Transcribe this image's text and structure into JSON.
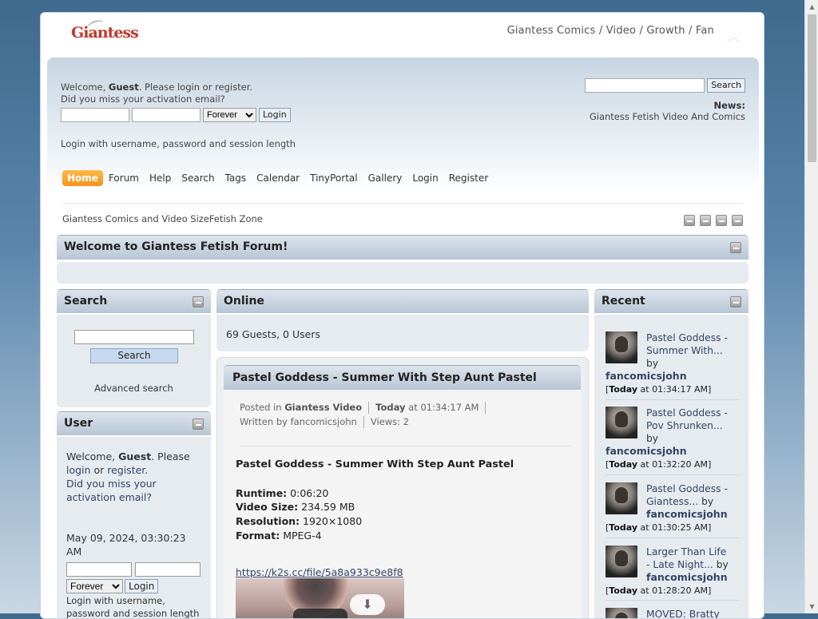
{
  "header": {
    "logo_text": "Giantess",
    "tagline": "Giantess Comics / Video / Growth / Fan"
  },
  "userbox": {
    "welcome_prefix": "Welcome,",
    "guest": "Guest",
    "welcome_suffix": ". Please login or register.",
    "activation": "Did you miss your activation email?",
    "session_option": "Forever",
    "login_button": "Login",
    "login_help": "Login with username, password and session length"
  },
  "search_top": {
    "button": "Search"
  },
  "news": {
    "label": "News:",
    "text": "Giantess Fetish Video And Comics"
  },
  "menu": {
    "items": [
      {
        "label": "Home"
      },
      {
        "label": "Forum"
      },
      {
        "label": "Help"
      },
      {
        "label": "Search"
      },
      {
        "label": "Tags"
      },
      {
        "label": "Calendar"
      },
      {
        "label": "TinyPortal"
      },
      {
        "label": "Gallery"
      },
      {
        "label": "Login"
      },
      {
        "label": "Register"
      }
    ]
  },
  "breadcrumb": "Giantess Comics and Video SizeFetish Zone",
  "welcome_block": {
    "title": "Welcome to Giantess Fetish Forum!"
  },
  "search_block": {
    "title": "Search",
    "button": "Search",
    "advanced": "Advanced search"
  },
  "user_block": {
    "title": "User",
    "welcome_prefix": "Welcome,",
    "guest": "Guest",
    "please": ". Please",
    "login": "login",
    "or": "or",
    "register": "register",
    "period": ".",
    "activation": "Did you miss your activation email?",
    "date": "May 09, 2024, 03:30:23 AM",
    "session_option": "Forever",
    "login_button": "Login",
    "help": "Login with username, password and session length"
  },
  "online_block": {
    "title": "Online",
    "text": "69 Guests, 0 Users"
  },
  "article": {
    "title": "Pastel Goddess - Summer With Step Aunt Pastel",
    "posted_in": "Posted in",
    "category": "Giantess Video",
    "today": "Today",
    "time": "at 01:34:17 AM",
    "written_by": "Written by fancomicsjohn",
    "views": "Views: 2",
    "content_title": "Pastel Goddess - Summer With Step Aunt Pastel",
    "runtime_label": "Runtime:",
    "runtime": "0:06:20",
    "size_label": "Video Size:",
    "size": "234.59 MB",
    "resolution_label": "Resolution:",
    "resolution": "1920×1080",
    "format_label": "Format:",
    "format": "MPEG-4",
    "link": "https://k2s.cc/file/5a8a933c9e8f8"
  },
  "recent_block": {
    "title": "Recent",
    "items": [
      {
        "title_a": "Pastel Goddess -",
        "title_b": "Summer With...",
        "by": "by",
        "author": "fancomicsjohn",
        "today": "Today",
        "time": " at 01:34:17 AM]"
      },
      {
        "title_a": "Pastel Goddess -",
        "title_b": "Pov Shrunken...",
        "by": "by",
        "author": "fancomicsjohn",
        "today": "Today",
        "time": " at 01:32:20 AM]"
      },
      {
        "title_a": "Pastel Goddess -",
        "title_b": "Giantess...",
        "by": "by",
        "author": "fancomicsjohn",
        "today": "Today",
        "time": " at 01:30:25 AM]"
      },
      {
        "title_a": "Larger Than Life",
        "title_b": "- Late Night...",
        "by": "by",
        "author": "fancomicsjohn",
        "today": "Today",
        "time": " at 01:28:20 AM]"
      },
      {
        "title_a": "MOVED: Bratty",
        "title_b": "",
        "by": "",
        "author": "",
        "today": "",
        "time": ""
      }
    ]
  }
}
